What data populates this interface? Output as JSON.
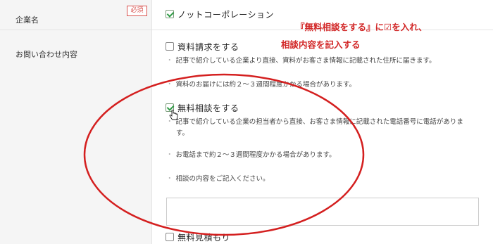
{
  "form": {
    "company_label": "企業名",
    "required_badge": "必須",
    "company_option": "ノットコーポレーション",
    "inquiry_label": "お問い合わせ内容"
  },
  "options": {
    "document": {
      "label": "資料請求をする",
      "note1": "記事で紹介している企業より直接、資料がお客さま情報に記載された住所に届きます。",
      "note2": "資料のお届けには約２〜３週間程度かかる場合があります。"
    },
    "consult": {
      "label": "無料相談をする",
      "note1a": "記事で紹介している企業の担当者から直接、お客さま情報に記載された電話番号に電話がありま",
      "note1b": "す。",
      "note2": "お電話まで約２〜３週間程度かかる場合があります。",
      "note3": "相談の内容をご記入ください。"
    },
    "estimate": {
      "label": "無料見積もり"
    }
  },
  "annotation": {
    "line1": "『無料相談をする』に☑を入れ、",
    "line2": "相談内容を記入する"
  },
  "colors": {
    "annotation": "#d22727",
    "check": "#2e9b44",
    "ellipse": "#d41f1f"
  }
}
